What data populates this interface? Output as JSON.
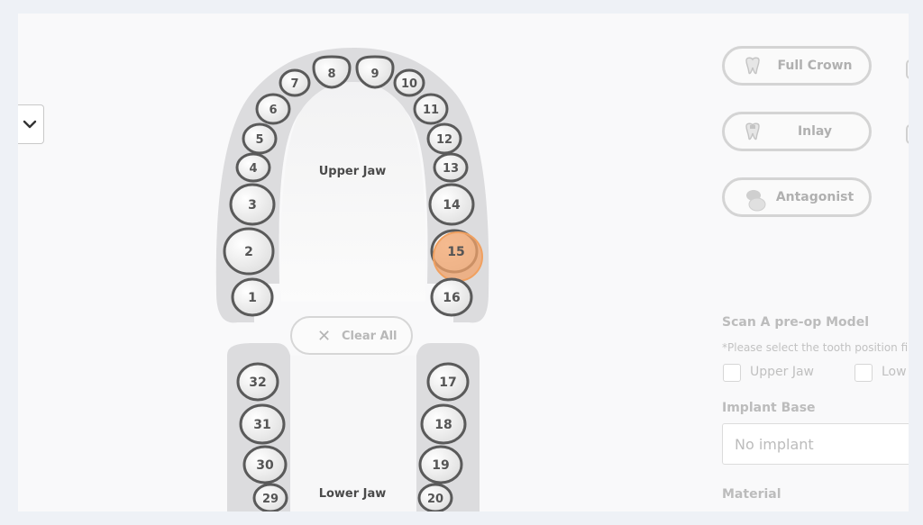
{
  "jaws": {
    "upper_label": "Upper Jaw",
    "lower_label": "Lower Jaw"
  },
  "teeth": {
    "t1": "1",
    "t2": "2",
    "t3": "3",
    "t4": "4",
    "t5": "5",
    "t6": "6",
    "t7": "7",
    "t8": "8",
    "t9": "9",
    "t10": "10",
    "t11": "11",
    "t12": "12",
    "t13": "13",
    "t14": "14",
    "t15": "15",
    "t16": "16",
    "t17": "17",
    "t18": "18",
    "t19": "19",
    "t20": "20",
    "t29": "29",
    "t30": "30",
    "t31": "31",
    "t32": "32"
  },
  "selected_tooth": "15",
  "clear_all_label": "Clear All",
  "restoration_types": {
    "full_crown": "Full Crown",
    "inlay": "Inlay",
    "antagonist": "Antagonist"
  },
  "scan_section": {
    "title": "Scan A pre-op Model",
    "hint": "*Please select the tooth position fi",
    "upper_jaw_label": "Upper Jaw",
    "lower_jaw_label": "Low"
  },
  "implant_base": {
    "label": "Implant Base",
    "value": "No implant"
  },
  "material": {
    "label": "Material"
  },
  "colors": {
    "selection": "#f2a36a",
    "arch": "#dcdcde"
  }
}
